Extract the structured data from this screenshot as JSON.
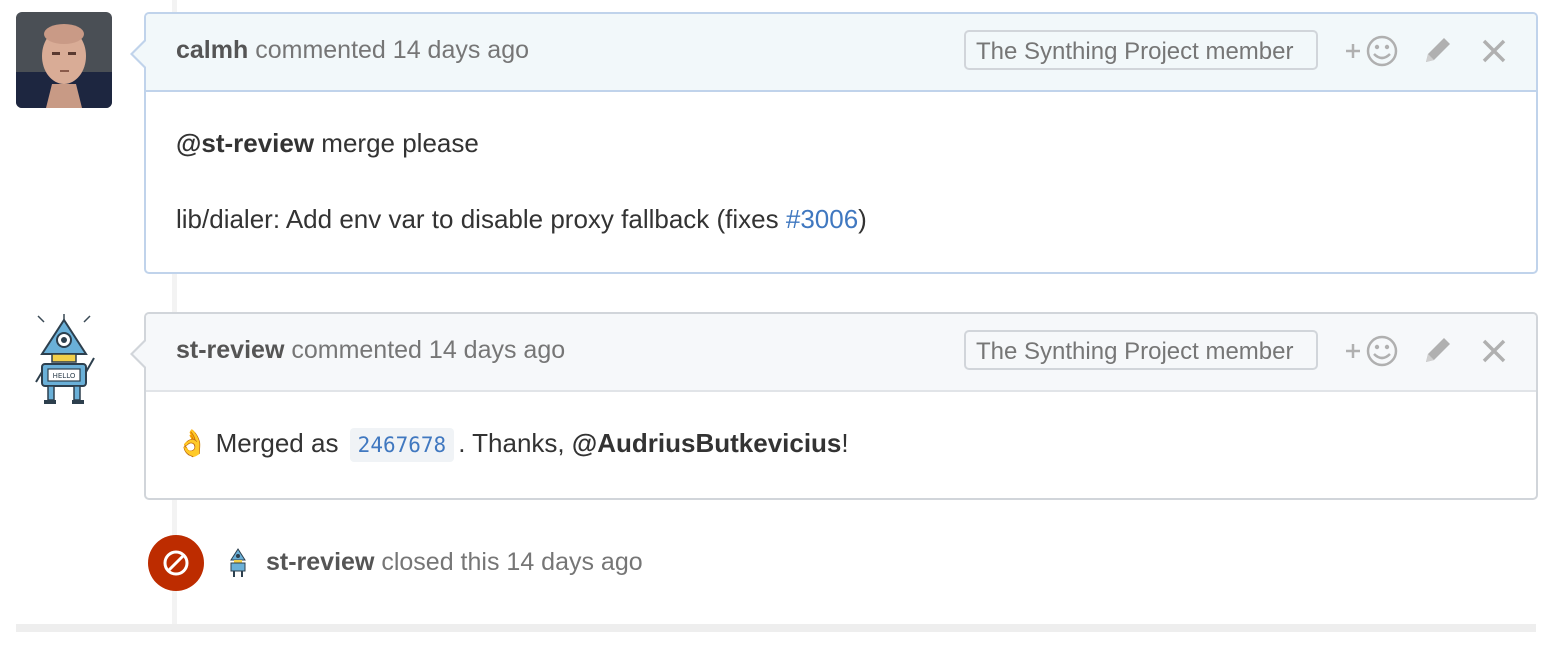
{
  "comments": [
    {
      "author": "calmh",
      "action": "commented",
      "time": "14 days ago",
      "badge": "The Synthing Project member",
      "body": {
        "mention": "@st-review",
        "line1_rest": " merge please",
        "line2_text": "lib/dialer: Add env var to disable proxy fallback (fixes ",
        "issue_ref": "#3006",
        "line2_end": ")"
      }
    },
    {
      "author": "st-review",
      "action": "commented",
      "time": "14 days ago",
      "badge": "The Synthing Project member",
      "body": {
        "emoji": "👌",
        "merged_prefix": " Merged as ",
        "commit_sha": "2467678",
        "thanks_text": ". Thanks, ",
        "mention": "@AudriusButkevicius",
        "end": "!"
      }
    }
  ],
  "event": {
    "actor": "st-review",
    "action": "closed this",
    "time": "14 days ago",
    "icon": "closed-icon"
  },
  "actions": {
    "add_reaction": "+",
    "icons": [
      "add-reaction-icon",
      "edit-pencil-icon",
      "delete-close-icon"
    ]
  },
  "colors": {
    "link": "#4078c0",
    "closed_badge": "#bd2c00",
    "current_user_border": "#c0d3eb"
  },
  "avatar_labels": {
    "robot_sign": "HELLO"
  }
}
